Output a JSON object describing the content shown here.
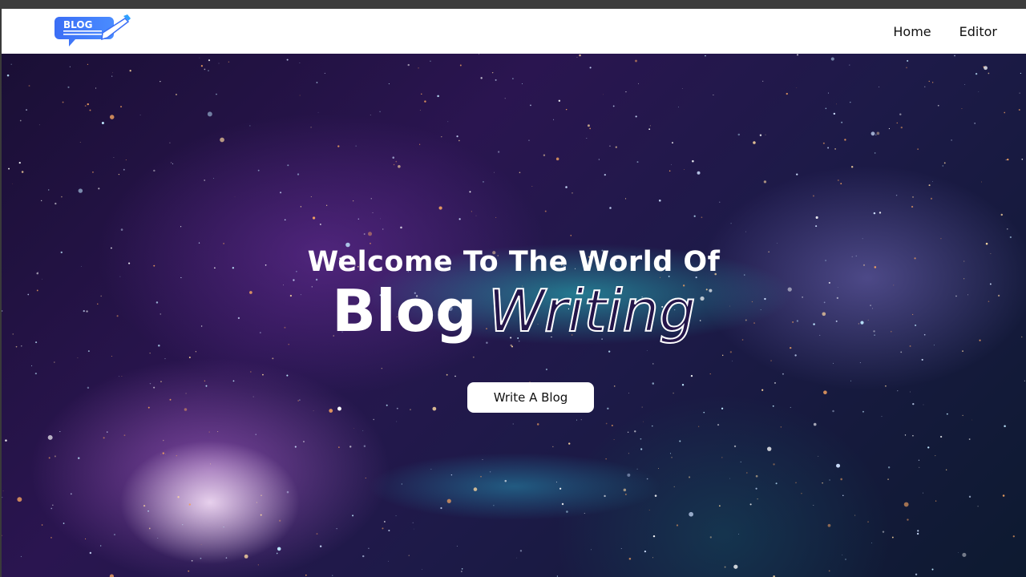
{
  "logo": {
    "text": "BLOG",
    "color": "#3b6ef5"
  },
  "nav": {
    "links": [
      "Home",
      "Editor"
    ]
  },
  "hero": {
    "title_line1": "Welcome To The World Of",
    "title_bold": "Blog",
    "title_outline": "Writing",
    "cta_label": "Write A Blog"
  }
}
